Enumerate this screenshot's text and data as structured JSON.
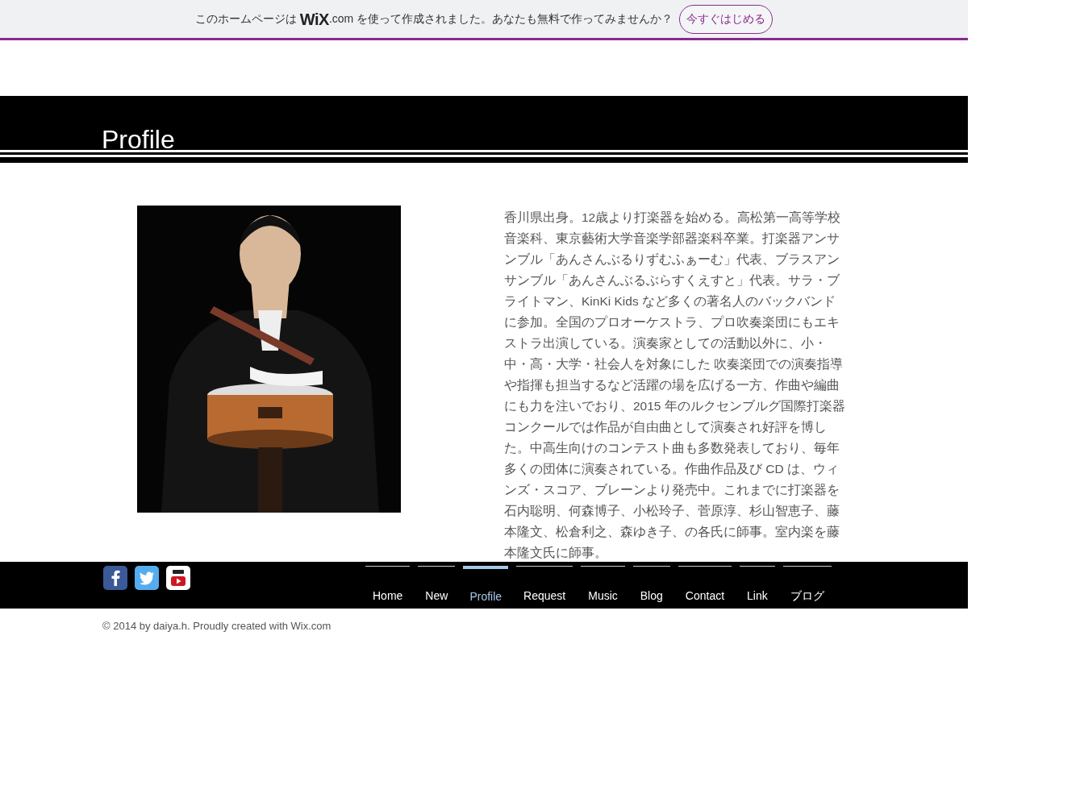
{
  "banner": {
    "before": "このホームページは",
    "logo": "WiX",
    "logo_suffix": ".com",
    "after": "を使って作成されました。あなたも無料で作ってみませんか？",
    "button": "今すぐはじめる"
  },
  "page_title": "Profile",
  "bio_lines": [
    "香川県出身。12歳より打楽器を始める。高松第一高等学校",
    "音楽科、東京藝術大学音楽学部器楽科卒業。打楽器アンサ",
    "ンブル「あんさんぶるりずむふぁーむ」代表、ブラスアン",
    "サンブル「あんさんぶるぶらすくえすと」代表。サラ・ブ",
    "ライトマン、KinKi Kids など多くの著名人のバックバンド",
    "に参加。全国のプロオーケストラ、プロ吹奏楽団にもエキ",
    "ストラ出演している。演奏家としての活動以外に、小・",
    "中・高・大学・社会人を対象にした 吹奏楽団での演奏指導",
    "や指揮も担当するなど活躍の場を広げる一方、作曲や編曲",
    "にも力を注いでおり、2015 年のルクセンブルグ国際打楽器",
    "コンクールでは作品が自由曲として演奏され好評を博し",
    "た。中高生向けのコンテスト曲も多数発表しており、毎年",
    "多くの団体に演奏されている。作曲作品及び CD は、ウィ",
    "ンズ・スコア、ブレーンより発売中。これまでに打楽器を",
    "石内聡明、何森博子、小松玲子、菅原淳、杉山智恵子、藤",
    "本隆文、松倉利之、森ゆき子、の各氏に師事。室内楽を藤",
    "本隆文氏に師事。"
  ],
  "social": [
    {
      "kind": "facebook"
    },
    {
      "kind": "twitter"
    },
    {
      "kind": "youtube"
    }
  ],
  "nav": [
    {
      "label": "Home",
      "selected": false
    },
    {
      "label": "New",
      "selected": false
    },
    {
      "label": "Profile",
      "selected": true
    },
    {
      "label": "Request",
      "selected": false
    },
    {
      "label": "Music",
      "selected": false
    },
    {
      "label": "Blog",
      "selected": false
    },
    {
      "label": "Contact",
      "selected": false
    },
    {
      "label": "Link",
      "selected": false
    },
    {
      "label": "ブログ",
      "selected": false
    }
  ],
  "copyright": "© 2014 by daiya.h. Proudly created with Wix.com"
}
